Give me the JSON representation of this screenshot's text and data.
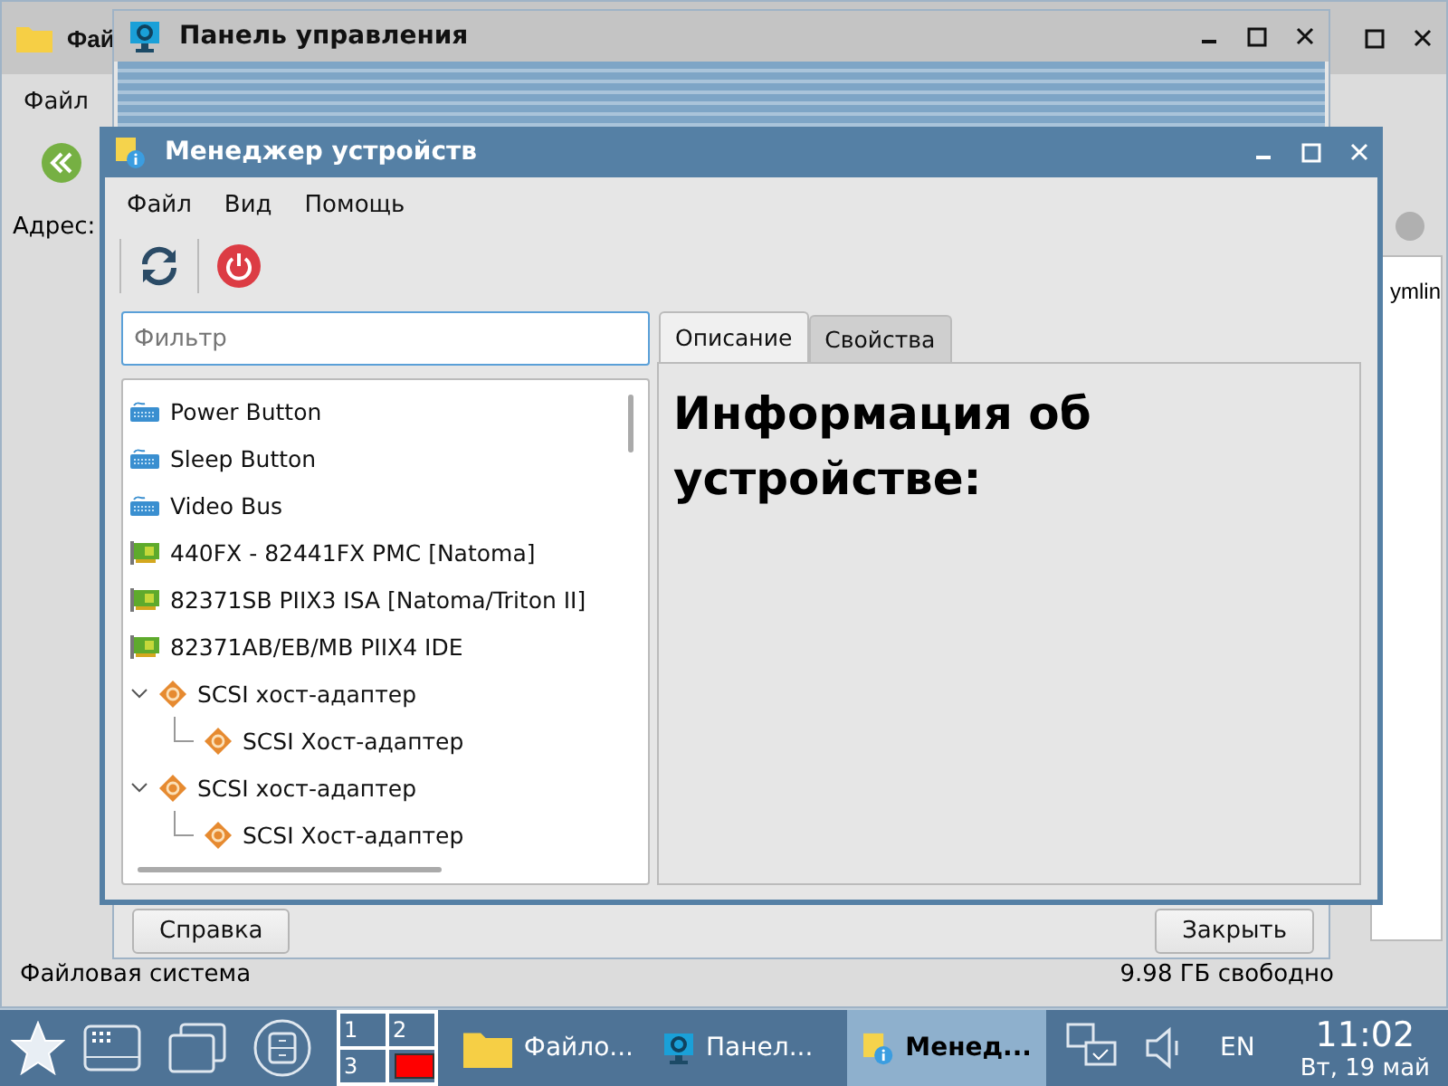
{
  "file_manager": {
    "title": "Фай",
    "menu": [
      "Файл"
    ],
    "address_label": "Адрес:",
    "visible_entry": "ymlin",
    "status": [
      "Файловая система",
      "9.98 ГБ свободно"
    ]
  },
  "control_panel": {
    "title": "Панель управления",
    "buttons": [
      "Справка",
      "Закрыть"
    ]
  },
  "device_manager": {
    "title": "Менеджер устройств",
    "menu": [
      "Файл",
      "Вид",
      "Помощь"
    ],
    "filter": {
      "placeholder": "Фильтр"
    },
    "tree": [
      {
        "label": "Power Button",
        "kind": "input"
      },
      {
        "label": "Sleep Button",
        "kind": "input"
      },
      {
        "label": "Video Bus",
        "kind": "input"
      },
      {
        "label": "440FX - 82441FX PMC [Natoma]",
        "kind": "card"
      },
      {
        "label": "82371SB PIIX3 ISA [Natoma/Triton II]",
        "kind": "card"
      },
      {
        "label": "82371AB/EB/MB PIIX4 IDE",
        "kind": "card"
      },
      {
        "label": "SCSI хост-адаптер",
        "kind": "scsi",
        "expanded": true,
        "children": [
          {
            "label": "SCSI Хост-адаптер",
            "kind": "scsi"
          }
        ]
      },
      {
        "label": "SCSI хост-адаптер",
        "kind": "scsi",
        "expanded": true,
        "children": [
          {
            "label": "SCSI Хост-адаптер",
            "kind": "scsi"
          }
        ]
      }
    ],
    "tabs": [
      {
        "label": "Описание",
        "selected": true
      },
      {
        "label": "Свойства",
        "selected": false
      }
    ],
    "heading": "Информация об устройстве:"
  },
  "taskbar": {
    "pager": [
      "1",
      "2",
      "3"
    ],
    "tasks": [
      {
        "label": "Файло...",
        "kind": "folder",
        "selected": false
      },
      {
        "label": "Панел...",
        "kind": "settings",
        "selected": false
      },
      {
        "label": "Менед...",
        "kind": "device",
        "selected": true
      }
    ],
    "language": "EN",
    "time": "11:02",
    "date": "Вт, 19 май"
  }
}
